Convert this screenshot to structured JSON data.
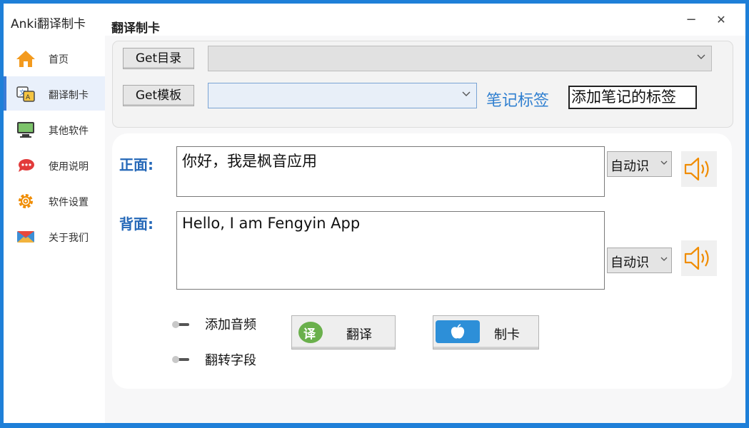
{
  "sidebar": {
    "app_title": "Anki翻译制卡",
    "items": [
      {
        "label": "首页",
        "icon": "home-icon"
      },
      {
        "label": "翻译制卡",
        "icon": "translate-card-icon"
      },
      {
        "label": "其他软件",
        "icon": "monitor-icon"
      },
      {
        "label": "使用说明",
        "icon": "chat-bubble-icon"
      },
      {
        "label": "软件设置",
        "icon": "gear-icon"
      },
      {
        "label": "关于我们",
        "icon": "envelope-icon"
      }
    ],
    "active_index": 1
  },
  "header": {
    "title": "翻译制卡",
    "minimize": "−",
    "close": "✕"
  },
  "top_panel": {
    "get_deck_label": "Get目录",
    "deck_value": "",
    "get_template_label": "Get模板",
    "template_value": "",
    "tag_label": "笔记标签",
    "tag_value": "添加笔记的标签"
  },
  "main": {
    "front_label": "正面:",
    "front_text": "你好，我是枫音应用",
    "front_lang": "自动识",
    "back_label": "背面:",
    "back_text": "Hello, I am Fengyin App",
    "back_lang": "自动识",
    "toggle_audio_label": "添加音频",
    "toggle_audio_on": false,
    "toggle_swap_label": "翻转字段",
    "toggle_swap_on": false,
    "translate_button": "翻译",
    "translate_badge": "译",
    "make_card_button": "制卡"
  },
  "colors": {
    "accent": "#2f7fd0",
    "label_blue": "#2568b8",
    "speaker_orange": "#f08c00",
    "translate_green": "#6ab04c",
    "card_blue": "#2d8fd8",
    "frame_blue": "#1e7fd8"
  }
}
